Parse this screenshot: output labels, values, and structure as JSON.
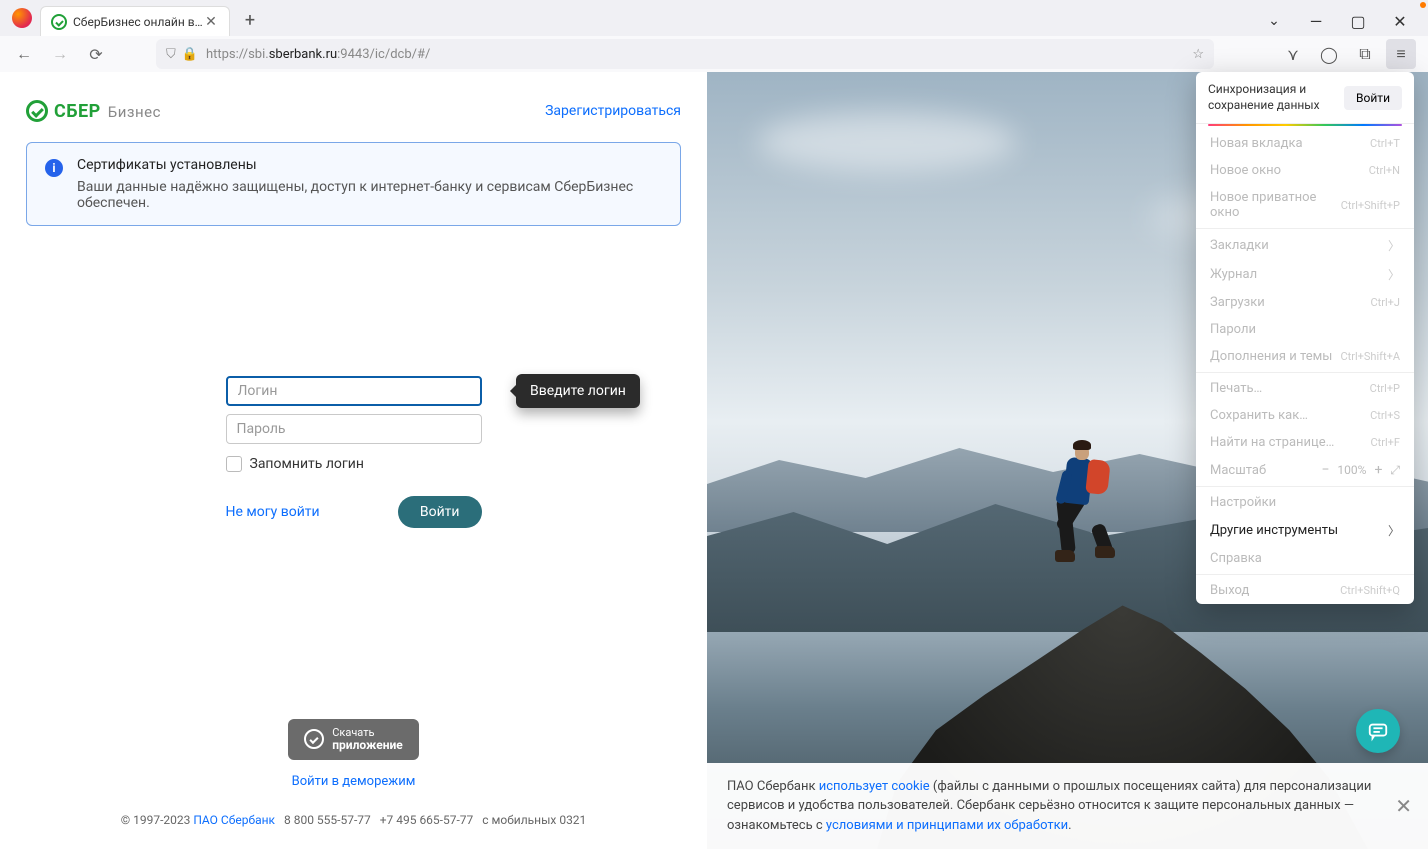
{
  "browser": {
    "tab_title": "СберБизнес онлайн вход в ли",
    "url_prefix": "https://",
    "url_host_dim1": "sbi.",
    "url_host": "sberbank.ru",
    "url_suffix": ":9443/ic/dcb/#/"
  },
  "header": {
    "logo_main": "СБЕР",
    "logo_sub": "Бизнес",
    "register": "Зарегистрироваться"
  },
  "banner": {
    "title": "Сертификаты установлены",
    "desc": "Ваши данные надёжно защищены, доступ к интернет-банку и сервисам СберБизнес обеспечен."
  },
  "login": {
    "login_placeholder": "Логин",
    "password_placeholder": "Пароль",
    "tooltip": "Введите логин",
    "remember": "Запомнить логин",
    "cant_login": "Не могу войти",
    "submit": "Войти"
  },
  "bottom": {
    "download_top": "Скачать",
    "download_bottom": "приложение",
    "demo": "Войти в деморежим"
  },
  "footer": {
    "copyright": "© 1997-2023 ",
    "company": "ПАО Сбербанк",
    "phone1": "8 800 555-57-77",
    "phone2": "+7 495 665-57-77",
    "mobile": "с мобильных 0321"
  },
  "cookie": {
    "p1a": "ПАО Сбербанк ",
    "link1": "использует cookie",
    "p1b": " (файлы с данными о прошлых посещениях сайта) для персонализации сервисов и удобства пользователей. Сбербанк серьёзно относится к защите персональных данных — ознакомьтесь с ",
    "link2": "условиями и принципами их обработки",
    "p1c": "."
  },
  "menu": {
    "sync_text": "Синхронизация и сохранение данных",
    "sync_btn": "Войти",
    "items": [
      {
        "label": "Новая вкладка",
        "shortcut": "Ctrl+T"
      },
      {
        "label": "Новое окно",
        "shortcut": "Ctrl+N"
      },
      {
        "label": "Новое приватное окно",
        "shortcut": "Ctrl+Shift+P"
      }
    ],
    "items2": [
      {
        "label": "Закладки",
        "chev": true
      },
      {
        "label": "Журнал",
        "chev": true
      },
      {
        "label": "Загрузки",
        "shortcut": "Ctrl+J"
      },
      {
        "label": "Пароли"
      },
      {
        "label": "Дополнения и темы",
        "shortcut": "Ctrl+Shift+A"
      }
    ],
    "items3": [
      {
        "label": "Печать…",
        "shortcut": "Ctrl+P"
      },
      {
        "label": "Сохранить как…",
        "shortcut": "Ctrl+S"
      },
      {
        "label": "Найти на странице…",
        "shortcut": "Ctrl+F"
      }
    ],
    "zoom_label": "Масштаб",
    "zoom_pct": "100%",
    "settings": "Настройки",
    "more_tools": "Другие инструменты",
    "help": "Справка",
    "exit": "Выход",
    "exit_shortcut": "Ctrl+Shift+Q"
  }
}
